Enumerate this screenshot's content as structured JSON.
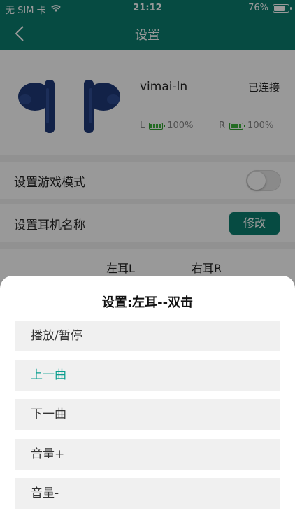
{
  "status_bar": {
    "carrier": "无 SIM 卡",
    "time": "21:12",
    "battery_percent": "76%",
    "battery_level": 0.76
  },
  "nav": {
    "title": "设置"
  },
  "device": {
    "name": "vimai-ln",
    "status": "已连接",
    "left": {
      "label": "L",
      "battery": "100%"
    },
    "right": {
      "label": "R",
      "battery": "100%"
    }
  },
  "settings": {
    "game_mode_label": "设置游戏模式",
    "game_mode_on": false,
    "headset_name_label": "设置耳机名称",
    "modify_button": "修改"
  },
  "ear_headers": {
    "left": "左耳L",
    "right": "右耳R"
  },
  "sheet": {
    "title": "设置:左耳--双击",
    "options": [
      "播放/暂停",
      "上一曲",
      "下一曲",
      "音量+",
      "音量-"
    ],
    "selected_option": "上一曲"
  },
  "colors": {
    "primary": "#0b7d6f",
    "selected_text": "#0b9e8f",
    "battery_green": "#3bb53b"
  }
}
